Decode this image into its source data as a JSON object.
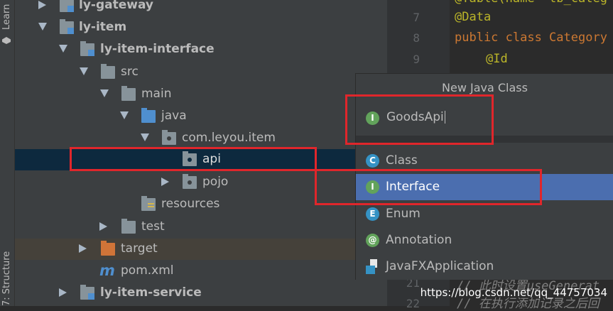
{
  "side_tabs": {
    "top": "Learn",
    "bottom": "7: Structure"
  },
  "project_tree": [
    {
      "label": "ly-gateway",
      "icon": "module-folder-icon",
      "arrow": "right",
      "bold": true
    },
    {
      "label": "ly-item",
      "icon": "module-folder-icon",
      "arrow": "down",
      "bold": true
    },
    {
      "label": "ly-item-interface",
      "icon": "module-folder-icon",
      "arrow": "down",
      "bold": true
    },
    {
      "label": "src",
      "icon": "folder-icon",
      "arrow": "down",
      "bold": false
    },
    {
      "label": "main",
      "icon": "folder-icon",
      "arrow": "down",
      "bold": false
    },
    {
      "label": "java",
      "icon": "source-folder-icon",
      "arrow": "down",
      "bold": false
    },
    {
      "label": "com.leyou.item",
      "icon": "package-icon",
      "arrow": "down",
      "bold": false
    },
    {
      "label": "api",
      "icon": "package-icon",
      "arrow": "",
      "bold": false,
      "selected": true
    },
    {
      "label": "pojo",
      "icon": "package-icon",
      "arrow": "right",
      "bold": false
    },
    {
      "label": "resources",
      "icon": "resources-folder-icon",
      "arrow": "",
      "bold": false
    },
    {
      "label": "test",
      "icon": "folder-icon",
      "arrow": "right",
      "bold": false
    },
    {
      "label": "target",
      "icon": "excluded-folder-icon",
      "arrow": "right",
      "bold": false
    },
    {
      "label": "pom.xml",
      "icon": "maven-icon",
      "arrow": "",
      "bold": false
    },
    {
      "label": "ly-item-service",
      "icon": "module-folder-icon",
      "arrow": "right",
      "bold": true
    }
  ],
  "editor": {
    "line_numbers": [
      "7",
      "8",
      "9",
      "10",
      "21",
      "22"
    ],
    "code_lines": [
      "@Table(name= tb_categ",
      "@Data",
      "public class Category",
      "@Id",
      "// 此时设置useGenerat",
      "// 在执行添加记录之后回"
    ]
  },
  "dialog": {
    "title": "New Java Class",
    "name_value": "GoodsApi",
    "name_icon": "I",
    "kinds": [
      {
        "label": "Class",
        "icon": "C",
        "color": "#3592c4"
      },
      {
        "label": "Interface",
        "icon": "I",
        "color": "#62a35b",
        "selected": true
      },
      {
        "label": "Enum",
        "icon": "E",
        "color": "#3592c4"
      },
      {
        "label": "Annotation",
        "icon": "@",
        "color": "#62a35b"
      },
      {
        "label": "JavaFXApplication",
        "icon": "javafx-icon",
        "color": "#3592c4"
      }
    ]
  },
  "watermark": "https://blog.csdn.net/qq_44757034",
  "colors": {
    "highlight_red": "#e0262b",
    "selection_blue": "#4b6eaf",
    "selected_row": "#0d293e",
    "excluded_row": "#45413a"
  }
}
